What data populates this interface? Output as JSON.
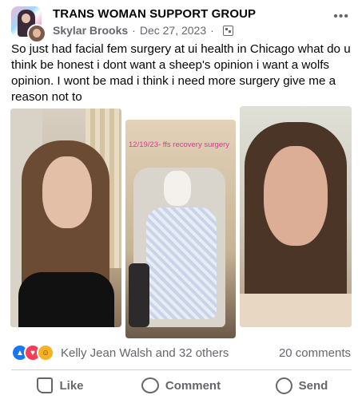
{
  "post": {
    "group_name": "TRANS WOMAN SUPPORT GROUP",
    "author": "Skylar Brooks",
    "separator": "·",
    "date": "Dec 27, 2023",
    "more_icon": "more-icon",
    "body": "So just had facial fem surgery at ui health in Chicago what do u think be honest i dont want a sheep's opinion i want a wolfs opinion. I wont be mad i think i need more surgery give me a reason not to",
    "photos": [
      {
        "caption": ""
      },
      {
        "caption": "12/19/23- ffs recovery surgery"
      },
      {
        "caption": ""
      }
    ]
  },
  "engagement": {
    "reaction_names": "Kelly Jean Walsh and 32 others",
    "comments": "20 comments",
    "reaction_icons": [
      "like-icon",
      "love-icon",
      "care-icon"
    ]
  },
  "actions": {
    "like": "Like",
    "comment": "Comment",
    "send": "Send"
  },
  "colors": {
    "like": "#1877f2",
    "love": "#f33e58",
    "care": "#f7b125",
    "secondary_text": "#65676b"
  }
}
